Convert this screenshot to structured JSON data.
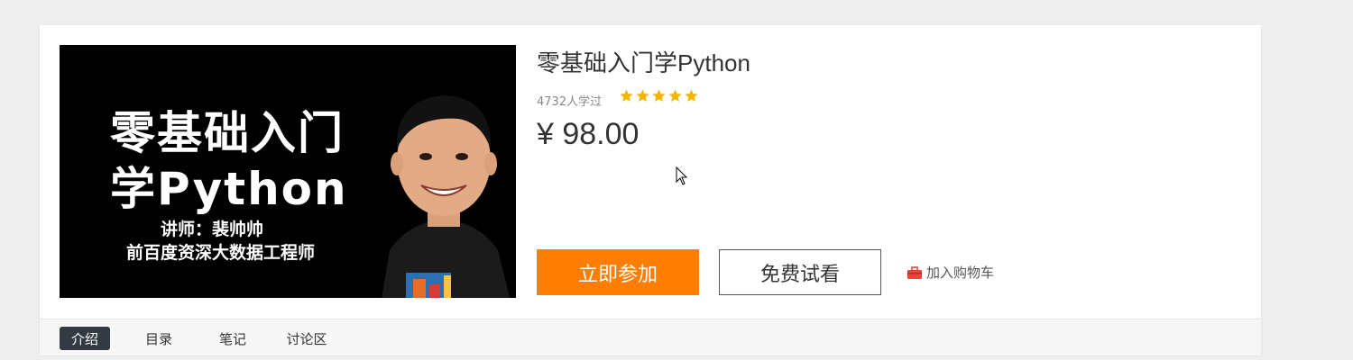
{
  "course": {
    "cover": {
      "line1": "零基础入门",
      "line2": "学Python",
      "line3": "讲师：裴帅帅",
      "line4": "前百度资深大数据工程师"
    },
    "title": "零基础入门学Python",
    "learners": "4732人学过",
    "rating_stars": 5,
    "price": "¥ 98.00"
  },
  "actions": {
    "join_label": "立即参加",
    "free_trial_label": "免费试看",
    "cart_label": "加入购物车",
    "cart_icon": "briefcase-icon"
  },
  "tabs": [
    {
      "label": "介绍",
      "active": true
    },
    {
      "label": "目录",
      "active": false
    },
    {
      "label": "笔记",
      "active": false
    },
    {
      "label": "讨论区",
      "active": false
    }
  ],
  "colors": {
    "accent": "#ff7d00",
    "star": "#f5b400",
    "tab_active_bg": "#333a42",
    "cart_icon": "#e8443a"
  }
}
